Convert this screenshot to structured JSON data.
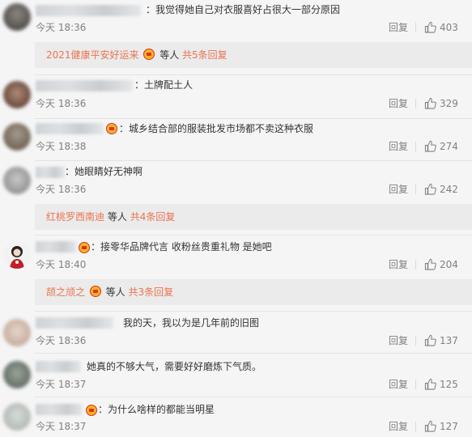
{
  "comments": [
    {
      "text": "：我觉得她自己对衣服喜好占很大一部分原因",
      "time": "今天 18:36",
      "reply": "回复",
      "likes": "403",
      "sub": {
        "user": "2021健康平安好运来",
        "suffix": "等人",
        "count": "共5条回复"
      }
    },
    {
      "text": "：土牌配土人",
      "time": "今天 18:36",
      "reply": "回复",
      "likes": "329"
    },
    {
      "text": "：城乡结合部的服装批发市场都不卖这种衣服",
      "time": "今天 18:38",
      "reply": "回复",
      "likes": "274"
    },
    {
      "text": "：她眼睛好无神啊",
      "time": "今天 18:36",
      "reply": "回复",
      "likes": "242",
      "sub": {
        "user": "红桃罗西南迪",
        "suffix": "等人",
        "count": "共4条回复"
      }
    },
    {
      "text": "：接零华品牌代言 收粉丝贵重礼物 是她吧",
      "time": "今天 18:40",
      "reply": "回复",
      "likes": "204",
      "sub": {
        "user": "颉之颃之",
        "suffix": "等人",
        "count": "共3条回复"
      }
    },
    {
      "text": "我的天，我以为是几年前的旧图",
      "time": "今天 18:36",
      "reply": "回复",
      "likes": "137"
    },
    {
      "text": "她真的不够大气，需要好好磨炼下气质。",
      "time": "今天 18:37",
      "reply": "回复",
      "likes": "125"
    },
    {
      "text": "：为什么啥样的都能当明星",
      "time": "今天 18:37",
      "reply": "回复",
      "likes": "127"
    }
  ],
  "colors": {
    "link": "#eb7350",
    "text": "#333333",
    "meta": "#808080",
    "background": "#f5f5f5",
    "subbox": "#ebebeb"
  },
  "icons": {
    "like": "thumbs-up-icon",
    "badge": "vip-badge-icon"
  }
}
